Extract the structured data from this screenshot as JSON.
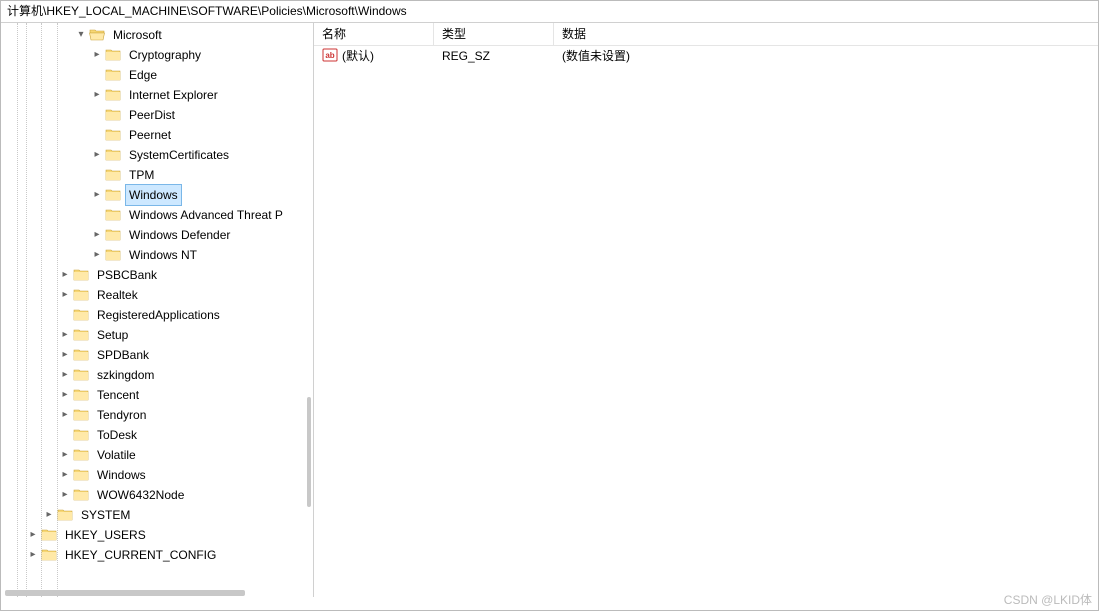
{
  "address_bar": "计算机\\HKEY_LOCAL_MACHINE\\SOFTWARE\\Policies\\Microsoft\\Windows",
  "columns": {
    "name": "名称",
    "type": "类型",
    "data": "数据"
  },
  "col_widths": {
    "name": 120,
    "type": 120,
    "data": 300
  },
  "rows": [
    {
      "icon": "string-value-icon",
      "name": "(默认)",
      "type": "REG_SZ",
      "data": "(数值未设置)"
    }
  ],
  "tree": [
    {
      "indent": 4,
      "expand": "open",
      "label": "Microsoft",
      "selected": false
    },
    {
      "indent": 5,
      "expand": "closed",
      "label": "Cryptography",
      "selected": false
    },
    {
      "indent": 5,
      "expand": "none",
      "label": "Edge",
      "selected": false
    },
    {
      "indent": 5,
      "expand": "closed",
      "label": "Internet Explorer",
      "selected": false
    },
    {
      "indent": 5,
      "expand": "none",
      "label": "PeerDist",
      "selected": false
    },
    {
      "indent": 5,
      "expand": "none",
      "label": "Peernet",
      "selected": false
    },
    {
      "indent": 5,
      "expand": "closed",
      "label": "SystemCertificates",
      "selected": false
    },
    {
      "indent": 5,
      "expand": "none",
      "label": "TPM",
      "selected": false
    },
    {
      "indent": 5,
      "expand": "closed",
      "label": "Windows",
      "selected": true
    },
    {
      "indent": 5,
      "expand": "none",
      "label": "Windows Advanced Threat P",
      "selected": false
    },
    {
      "indent": 5,
      "expand": "closed",
      "label": "Windows Defender",
      "selected": false
    },
    {
      "indent": 5,
      "expand": "closed",
      "label": "Windows NT",
      "selected": false
    },
    {
      "indent": 3,
      "expand": "closed",
      "label": "PSBCBank",
      "selected": false
    },
    {
      "indent": 3,
      "expand": "closed",
      "label": "Realtek",
      "selected": false
    },
    {
      "indent": 3,
      "expand": "none",
      "label": "RegisteredApplications",
      "selected": false
    },
    {
      "indent": 3,
      "expand": "closed",
      "label": "Setup",
      "selected": false
    },
    {
      "indent": 3,
      "expand": "closed",
      "label": "SPDBank",
      "selected": false
    },
    {
      "indent": 3,
      "expand": "closed",
      "label": "szkingdom",
      "selected": false
    },
    {
      "indent": 3,
      "expand": "closed",
      "label": "Tencent",
      "selected": false
    },
    {
      "indent": 3,
      "expand": "closed",
      "label": "Tendyron",
      "selected": false
    },
    {
      "indent": 3,
      "expand": "none",
      "label": "ToDesk",
      "selected": false
    },
    {
      "indent": 3,
      "expand": "closed",
      "label": "Volatile",
      "selected": false
    },
    {
      "indent": 3,
      "expand": "closed",
      "label": "Windows",
      "selected": false
    },
    {
      "indent": 3,
      "expand": "closed",
      "label": "WOW6432Node",
      "selected": false
    },
    {
      "indent": 2,
      "expand": "closed",
      "label": "SYSTEM",
      "selected": false
    },
    {
      "indent": 1,
      "expand": "closed",
      "label": "HKEY_USERS",
      "selected": false
    },
    {
      "indent": 1,
      "expand": "closed",
      "label": "HKEY_CURRENT_CONFIG",
      "selected": false
    }
  ],
  "indent_unit": 16,
  "base_indent": 10,
  "watermark": "CSDN @LKID体"
}
